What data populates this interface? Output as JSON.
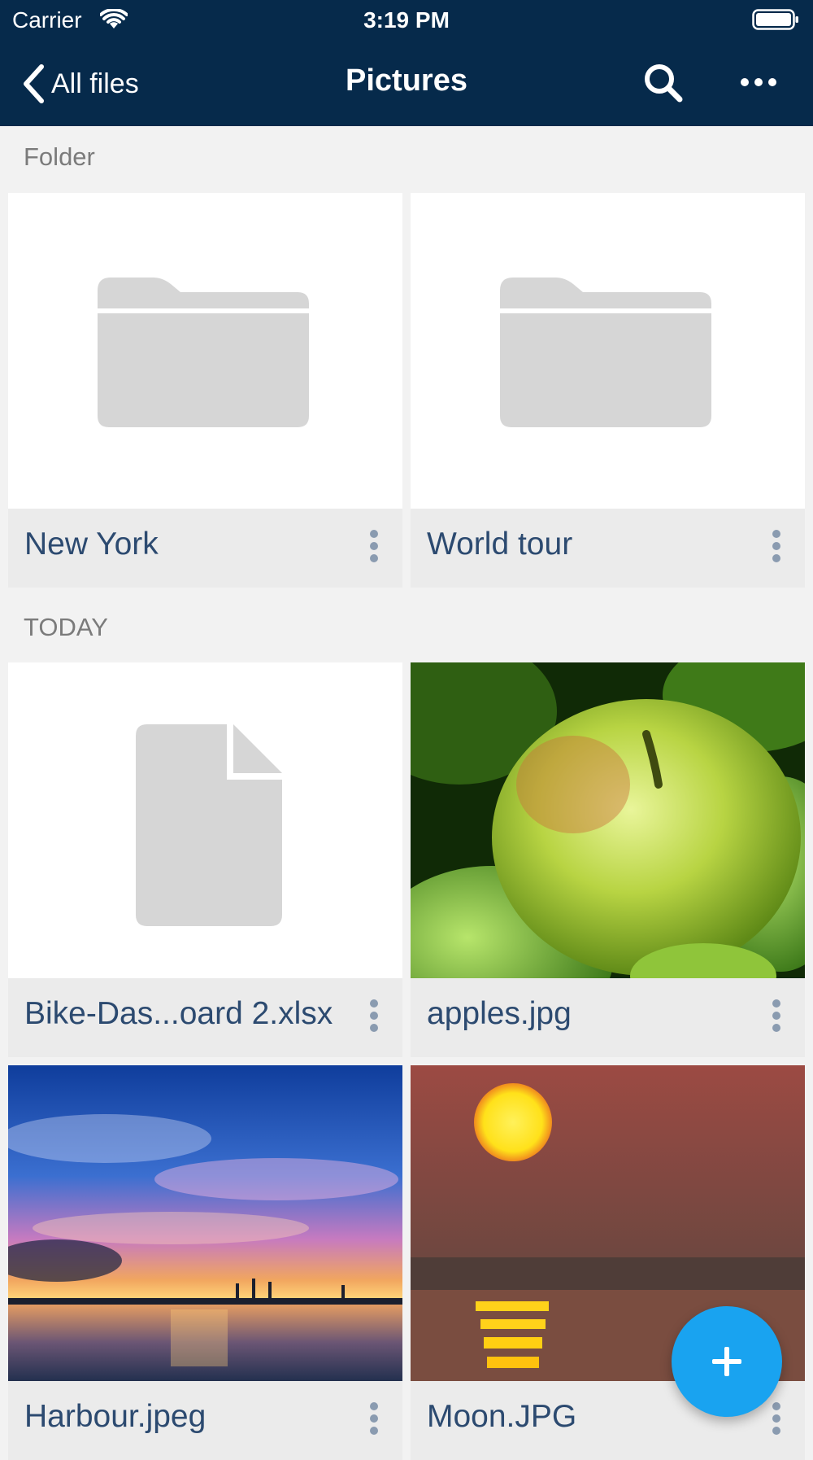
{
  "status": {
    "carrier": "Carrier",
    "time": "3:19 PM"
  },
  "nav": {
    "back_label": "All files",
    "title": "Pictures"
  },
  "sections": {
    "folder": "Folder",
    "today": "TODAY"
  },
  "folders": [
    {
      "name": "New York"
    },
    {
      "name": "World tour"
    }
  ],
  "files": [
    {
      "name": "Bike-Das...oard 2.xlsx"
    },
    {
      "name": "apples.jpg"
    },
    {
      "name": "Harbour.jpeg"
    },
    {
      "name": "Moon.JPG"
    }
  ],
  "colors": {
    "nav_bar": "#062a4b",
    "fab": "#19a3f0",
    "caption_text": "#2c4a70"
  },
  "icons": {
    "back": "chevron-left-icon",
    "search": "search-icon",
    "more": "more-horizontal-icon",
    "add": "plus-icon"
  }
}
